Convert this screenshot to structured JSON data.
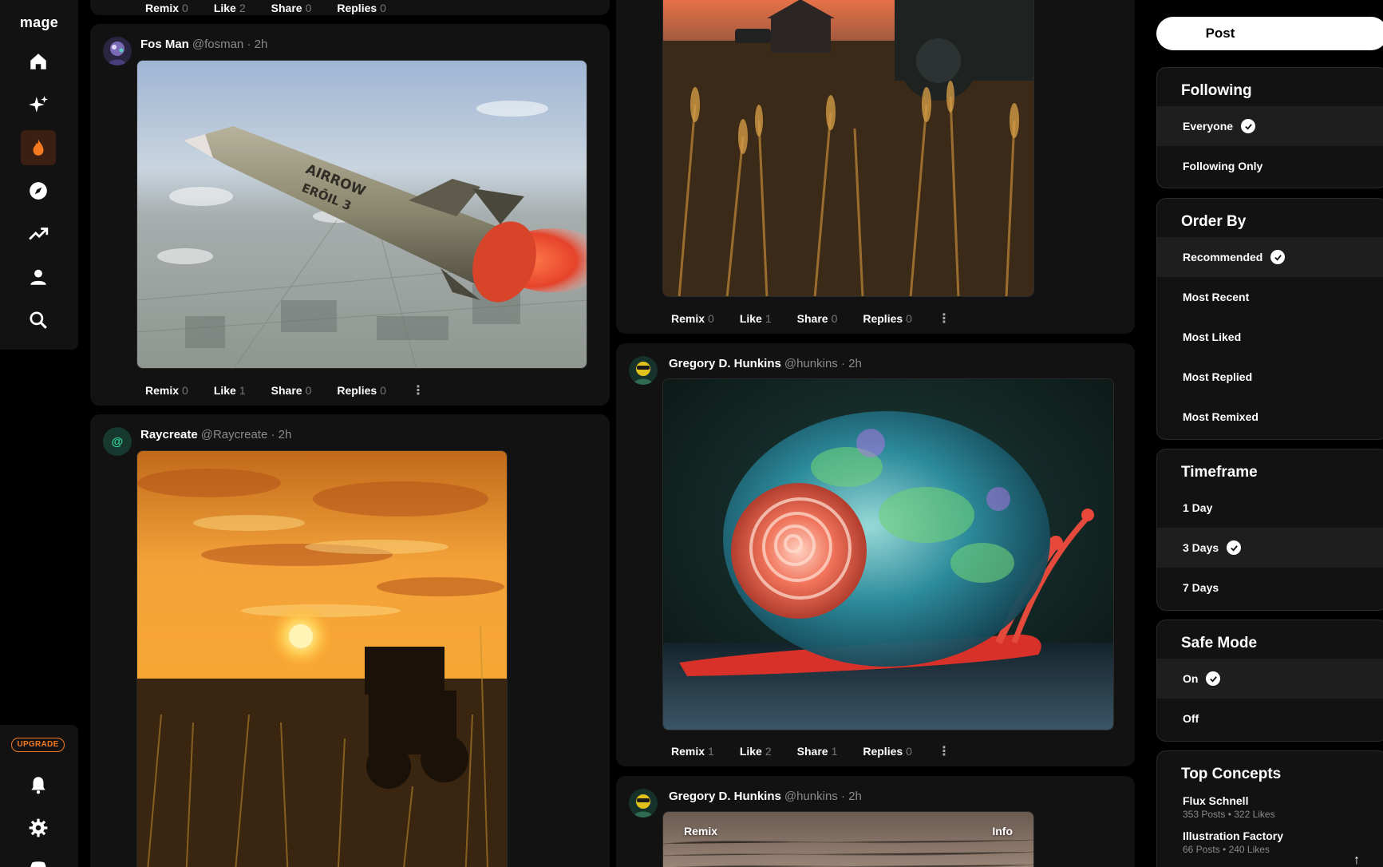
{
  "app": {
    "logo": "mage",
    "upgrade_label": "UPGRADE"
  },
  "nav": [
    "home-icon",
    "sparkles-icon",
    "fire-icon",
    "compass-icon",
    "trending-icon",
    "user-icon",
    "search-icon"
  ],
  "colors": {
    "accent": "#f47a1f",
    "bg": "#000000",
    "card": "#121212"
  },
  "top_partial": {
    "actions": [
      {
        "label": "Remix",
        "count": "0"
      },
      {
        "label": "Like",
        "count": "2"
      },
      {
        "label": "Share",
        "count": "0"
      },
      {
        "label": "Replies",
        "count": "0"
      }
    ]
  },
  "posts": [
    {
      "name": "Fos Man",
      "handle": "@fosman",
      "time": "· 2h",
      "actions": [
        {
          "label": "Remix",
          "count": "0"
        },
        {
          "label": "Like",
          "count": "1"
        },
        {
          "label": "Share",
          "count": "0"
        },
        {
          "label": "Replies",
          "count": "0"
        }
      ]
    },
    {
      "name": "Raycreate",
      "handle": "@Raycreate",
      "time": "· 2h"
    },
    {
      "actions": [
        {
          "label": "Remix",
          "count": "0"
        },
        {
          "label": "Like",
          "count": "1"
        },
        {
          "label": "Share",
          "count": "0"
        },
        {
          "label": "Replies",
          "count": "0"
        }
      ]
    },
    {
      "name": "Gregory D. Hunkins",
      "handle": "@hunkins",
      "time": "· 2h",
      "actions": [
        {
          "label": "Remix",
          "count": "1"
        },
        {
          "label": "Like",
          "count": "2"
        },
        {
          "label": "Share",
          "count": "1"
        },
        {
          "label": "Replies",
          "count": "0"
        }
      ]
    },
    {
      "name": "Gregory D. Hunkins",
      "handle": "@hunkins",
      "time": "· 2h",
      "img_left": "Remix",
      "img_right": "Info"
    }
  ],
  "rocket_text": [
    "AIRROW",
    "ERŌIL 3"
  ],
  "right": {
    "post_label": "Post",
    "following": {
      "title": "Following",
      "options": [
        "Everyone",
        "Following Only"
      ]
    },
    "order_by": {
      "title": "Order By",
      "options": [
        "Recommended",
        "Most Recent",
        "Most Liked",
        "Most Replied",
        "Most Remixed"
      ]
    },
    "timeframe": {
      "title": "Timeframe",
      "options": [
        "1 Day",
        "3 Days",
        "7 Days"
      ]
    },
    "safe_mode": {
      "title": "Safe Mode",
      "options": [
        "On",
        "Off"
      ]
    },
    "top_concepts": {
      "title": "Top Concepts",
      "items": [
        {
          "title": "Flux Schnell",
          "stats": "353 Posts • 322 Likes"
        },
        {
          "title": "Illustration Factory",
          "stats": "66 Posts • 240 Likes"
        }
      ]
    }
  }
}
